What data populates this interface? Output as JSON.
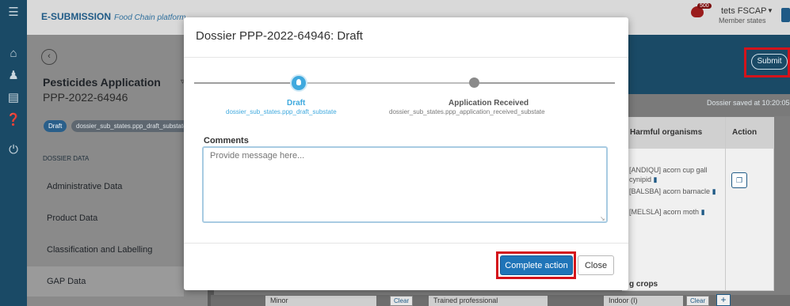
{
  "topbar": {
    "brand": "E-SUBMISSION",
    "brand_subtitle": "Food Chain platform",
    "notification_count": "500",
    "user_name": "tets FSCAP",
    "user_role": "Member states"
  },
  "rail": {
    "icons": [
      "menu-icon",
      "home-icon",
      "users-icon",
      "clipboard-icon",
      "help-icon",
      "power-icon"
    ]
  },
  "sidebar": {
    "app_title": "Pesticides Application",
    "app_code": "PPP-2022-64946",
    "state_pill": "Draft",
    "substate_pill": "dossier_sub_states.ppp_draft_substate",
    "section_header": "DOSSIER DATA",
    "items": [
      {
        "label": "Administrative Data"
      },
      {
        "label": "Product Data"
      },
      {
        "label": "Classification and Labelling"
      },
      {
        "label": "GAP Data"
      }
    ]
  },
  "header": {
    "submit_label": "Submit",
    "saved_text": "Dossier saved at 10:20:05"
  },
  "table": {
    "col_harmful": "Harmful organisms",
    "col_action": "Action",
    "organisms": [
      {
        "text": "[ANDIQU] acorn cup gall cynipid"
      },
      {
        "text": "[BALSBA] acorn barnacle"
      },
      {
        "text": "[MELSLA] acorn moth"
      }
    ],
    "crops_label": "g crops"
  },
  "bottom_row": {
    "field1": "Minor",
    "field2": "Trained professional",
    "field3": "Indoor (I)",
    "clear_label": "Clear",
    "add_label": "+"
  },
  "modal": {
    "title": "Dossier PPP-2022-64946: Draft",
    "steps": [
      {
        "label": "Draft",
        "sub": "dossier_sub_states.ppp_draft_substate",
        "active": true
      },
      {
        "label": "Application Received",
        "sub": "dossier_sub_states.ppp_application_received_substate",
        "active": false
      }
    ],
    "comments_label": "Comments",
    "comments_value": "Provide message here...",
    "complete_label": "Complete action",
    "close_label": "Close"
  },
  "colors": {
    "rail": "#1a4a66",
    "accent": "#3fa9de",
    "primary_button": "#1f74b8",
    "highlight": "#d4131b"
  }
}
